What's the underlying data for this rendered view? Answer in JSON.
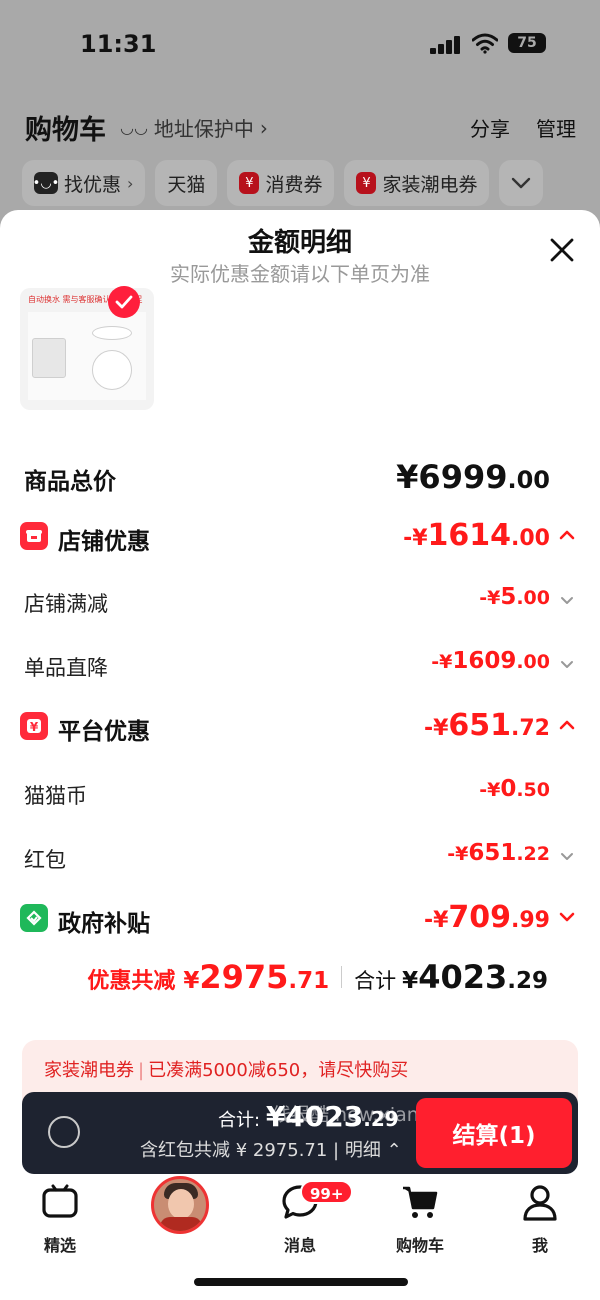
{
  "status": {
    "time": "11:31",
    "battery": "75"
  },
  "cart_header": {
    "title": "购物车",
    "address_protect": "地址保护中",
    "share": "分享",
    "manage": "管理"
  },
  "chips": [
    {
      "label": "找优惠",
      "icon": "coupon-face-icon"
    },
    {
      "label": "天猫"
    },
    {
      "label": "消费券",
      "icon": "red-coupon-icon"
    },
    {
      "label": "家装潮电券",
      "icon": "red-coupon-icon"
    }
  ],
  "sheet": {
    "title": "金额明细",
    "subtitle": "实际优惠金额请以下单页为准",
    "product_thumb_caption": "自动换水 需与客服确认是否满足"
  },
  "rows": {
    "total": {
      "label": "商品总价",
      "cur": "¥",
      "int": "6999",
      "dec": ".00"
    },
    "store_discount": {
      "label": "店铺优惠",
      "sign": "-¥",
      "int": "1614",
      "dec": ".00"
    },
    "store_full_reduction": {
      "label": "店铺满减",
      "sign": "-¥",
      "int": "5",
      "dec": ".00"
    },
    "item_direct_drop": {
      "label": "单品直降",
      "sign": "-¥",
      "int": "1609",
      "dec": ".00"
    },
    "platform_discount": {
      "label": "平台优惠",
      "sign": "-¥",
      "int": "651",
      "dec": ".72"
    },
    "cat_coin": {
      "label": "猫猫币",
      "sign": "-¥",
      "int": "0",
      "dec": ".50"
    },
    "red_packet": {
      "label": "红包",
      "sign": "-¥",
      "int": "651",
      "dec": ".22"
    },
    "gov_subsidy": {
      "label": "政府补贴",
      "sign": "-¥",
      "int": "709",
      "dec": ".99"
    }
  },
  "summary": {
    "discount_label": "优惠共减",
    "discount_cur": "¥",
    "discount_int": "2975",
    "discount_dec": ".71",
    "total_label": "合计",
    "total_cur": "¥",
    "total_int": "4023",
    "total_dec": ".29"
  },
  "promo": {
    "tag": "家装潮电券",
    "text": "已凑满5000减650，请尽快购买"
  },
  "checkout": {
    "total_label": "合计:",
    "total_cur": "¥",
    "total_int": "4023",
    "total_dec": ".29",
    "detail_text": "含红包共减 ¥ 2975.71 | 明细",
    "pay_label": "结算(1)",
    "watermark": "线报酷 new.xianbao.fun"
  },
  "tabs": [
    {
      "label": "精选"
    },
    {
      "label": ""
    },
    {
      "label": "消息",
      "badge": "99+"
    },
    {
      "label": "购物车"
    },
    {
      "label": "我"
    }
  ],
  "colors": {
    "accent": "#ff1a1a",
    "checkout_bg": "#1e2330",
    "pay": "#ff1f2e",
    "gov_green": "#1fb85a"
  }
}
